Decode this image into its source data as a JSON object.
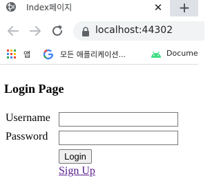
{
  "browser": {
    "tab": {
      "title": "Index페이지",
      "favicon_icon": "globe-icon",
      "close_symbol": "✕"
    },
    "new_tab_symbol": "+",
    "toolbar": {
      "back_icon": "back-arrow-icon",
      "forward_icon": "forward-arrow-icon",
      "reload_icon": "reload-icon",
      "lock_icon": "lock-icon",
      "url": "localhost:44302"
    },
    "bookmarks": [
      {
        "icon": "apps-grid-icon",
        "label": "앱"
      },
      {
        "icon": "google-g-icon",
        "label": "모든 애플리케이션..."
      },
      {
        "icon": "android-icon",
        "label": "Docume"
      }
    ]
  },
  "page": {
    "title": "Login Page",
    "username_label": "Username",
    "password_label": "Password",
    "username_value": "",
    "password_value": "",
    "login_button": "Login",
    "signup_link": "Sign Up"
  },
  "colors": {
    "tab_strip": "#dee1e6",
    "omnibox": "#f1f3f4",
    "visited_link": "#551a8b",
    "google_blue": "#4285f4",
    "android_green": "#3ddc84"
  }
}
